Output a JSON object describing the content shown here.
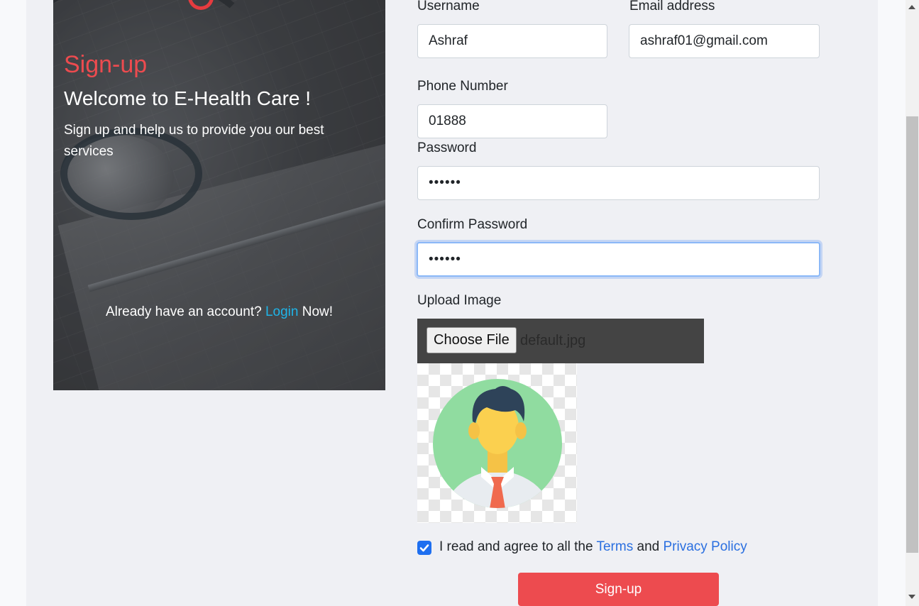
{
  "hero": {
    "title": "Sign-up",
    "welcome": "Welcome to E-Health Care !",
    "subtitle": "Sign up and help us to provide you our best services",
    "login_prefix": "Already have an account?",
    "login_link": "Login",
    "login_suffix": "Now!"
  },
  "form": {
    "username": {
      "label": "Username",
      "value": "Ashraf"
    },
    "email": {
      "label": "Email address",
      "value": "ashraf01@gmail.com"
    },
    "phone": {
      "label": "Phone Number",
      "value": "01888"
    },
    "password": {
      "label": "Password",
      "value": "••••••"
    },
    "confirm_password": {
      "label": "Confirm Password",
      "value": "••••••"
    },
    "upload": {
      "label": "Upload Image",
      "button": "Choose File",
      "file_name": "default.jpg"
    },
    "terms": {
      "checked": true,
      "prefix": "I read and agree to all the",
      "terms_link": "Terms",
      "and": "and",
      "privacy_link": "Privacy Policy"
    },
    "submit_label": "Sign-up"
  },
  "colors": {
    "accent": "#ed4b4f",
    "link": "#2a6fe0",
    "login_link": "#1fb4e8",
    "checkbox": "#1e6ff0"
  },
  "icons": {
    "avatar": "user-avatar-icon",
    "check": "check-icon"
  }
}
